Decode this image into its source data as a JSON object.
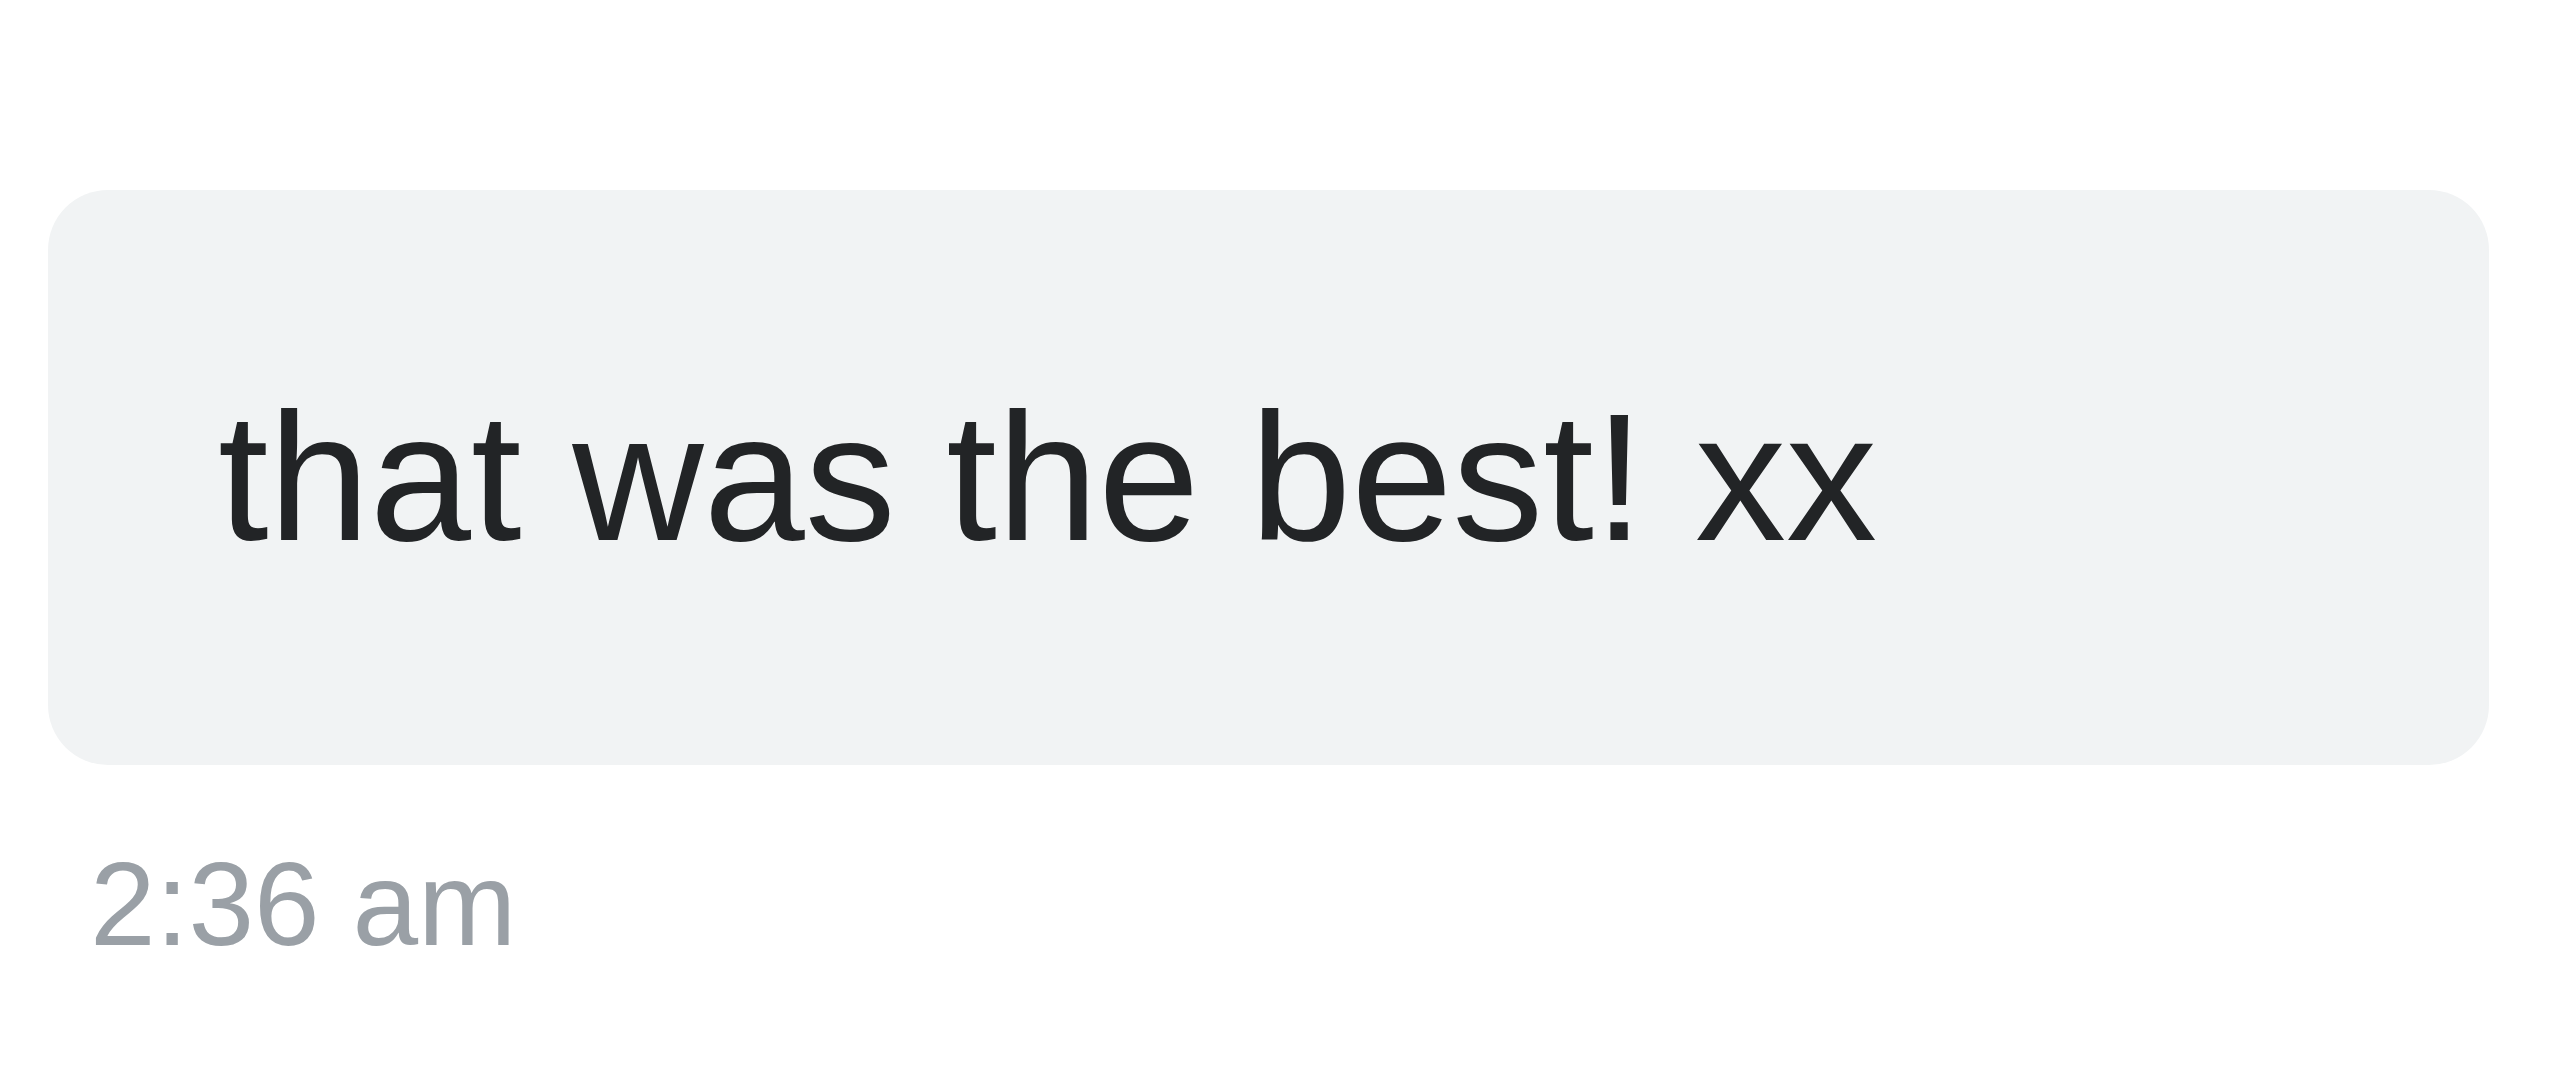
{
  "message": {
    "text": "that was the best! xx"
  },
  "time": "2:36 am"
}
